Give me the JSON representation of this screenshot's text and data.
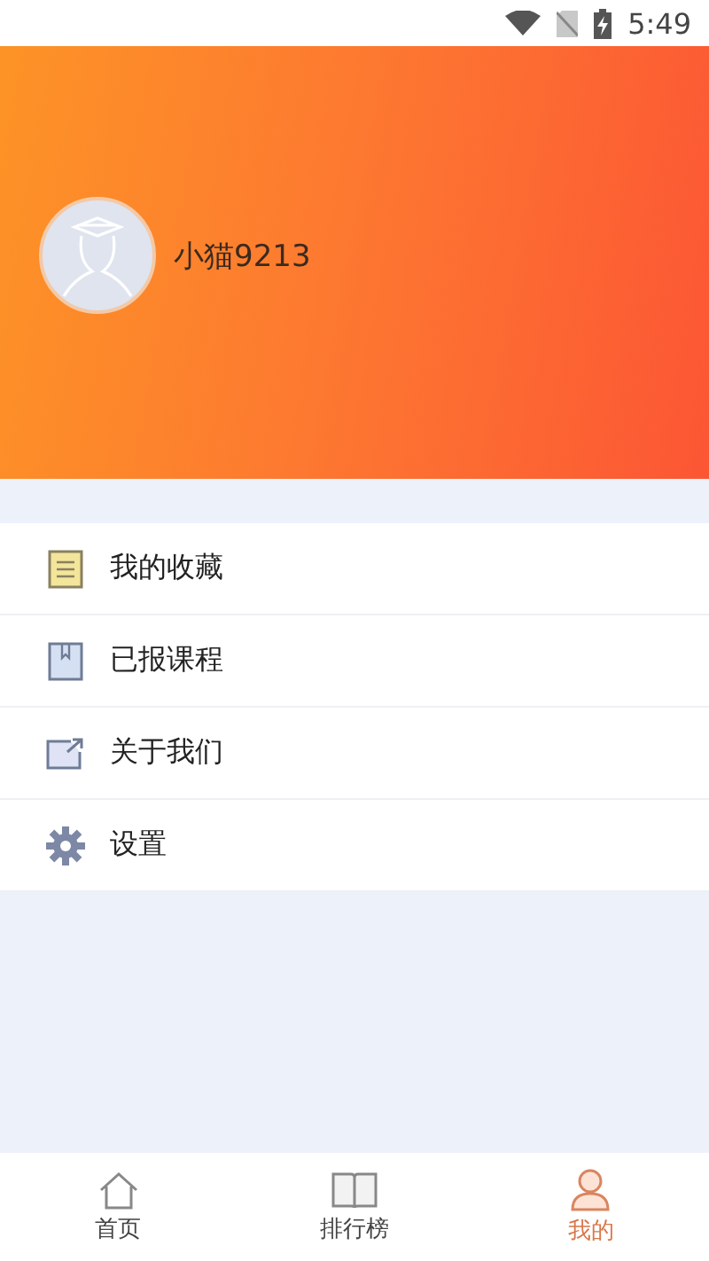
{
  "status_bar": {
    "time": "5:49"
  },
  "profile": {
    "username": "小猫9213"
  },
  "menu": [
    {
      "kind": "notes",
      "label": "我的收藏"
    },
    {
      "kind": "book",
      "label": "已报课程"
    },
    {
      "kind": "share",
      "label": "关于我们"
    },
    {
      "kind": "gear",
      "label": "设置"
    }
  ],
  "tabs": [
    {
      "kind": "home",
      "label": "首页",
      "selected": false
    },
    {
      "kind": "ranking",
      "label": "排行榜",
      "selected": false
    },
    {
      "kind": "me",
      "label": "我的",
      "selected": true
    }
  ]
}
